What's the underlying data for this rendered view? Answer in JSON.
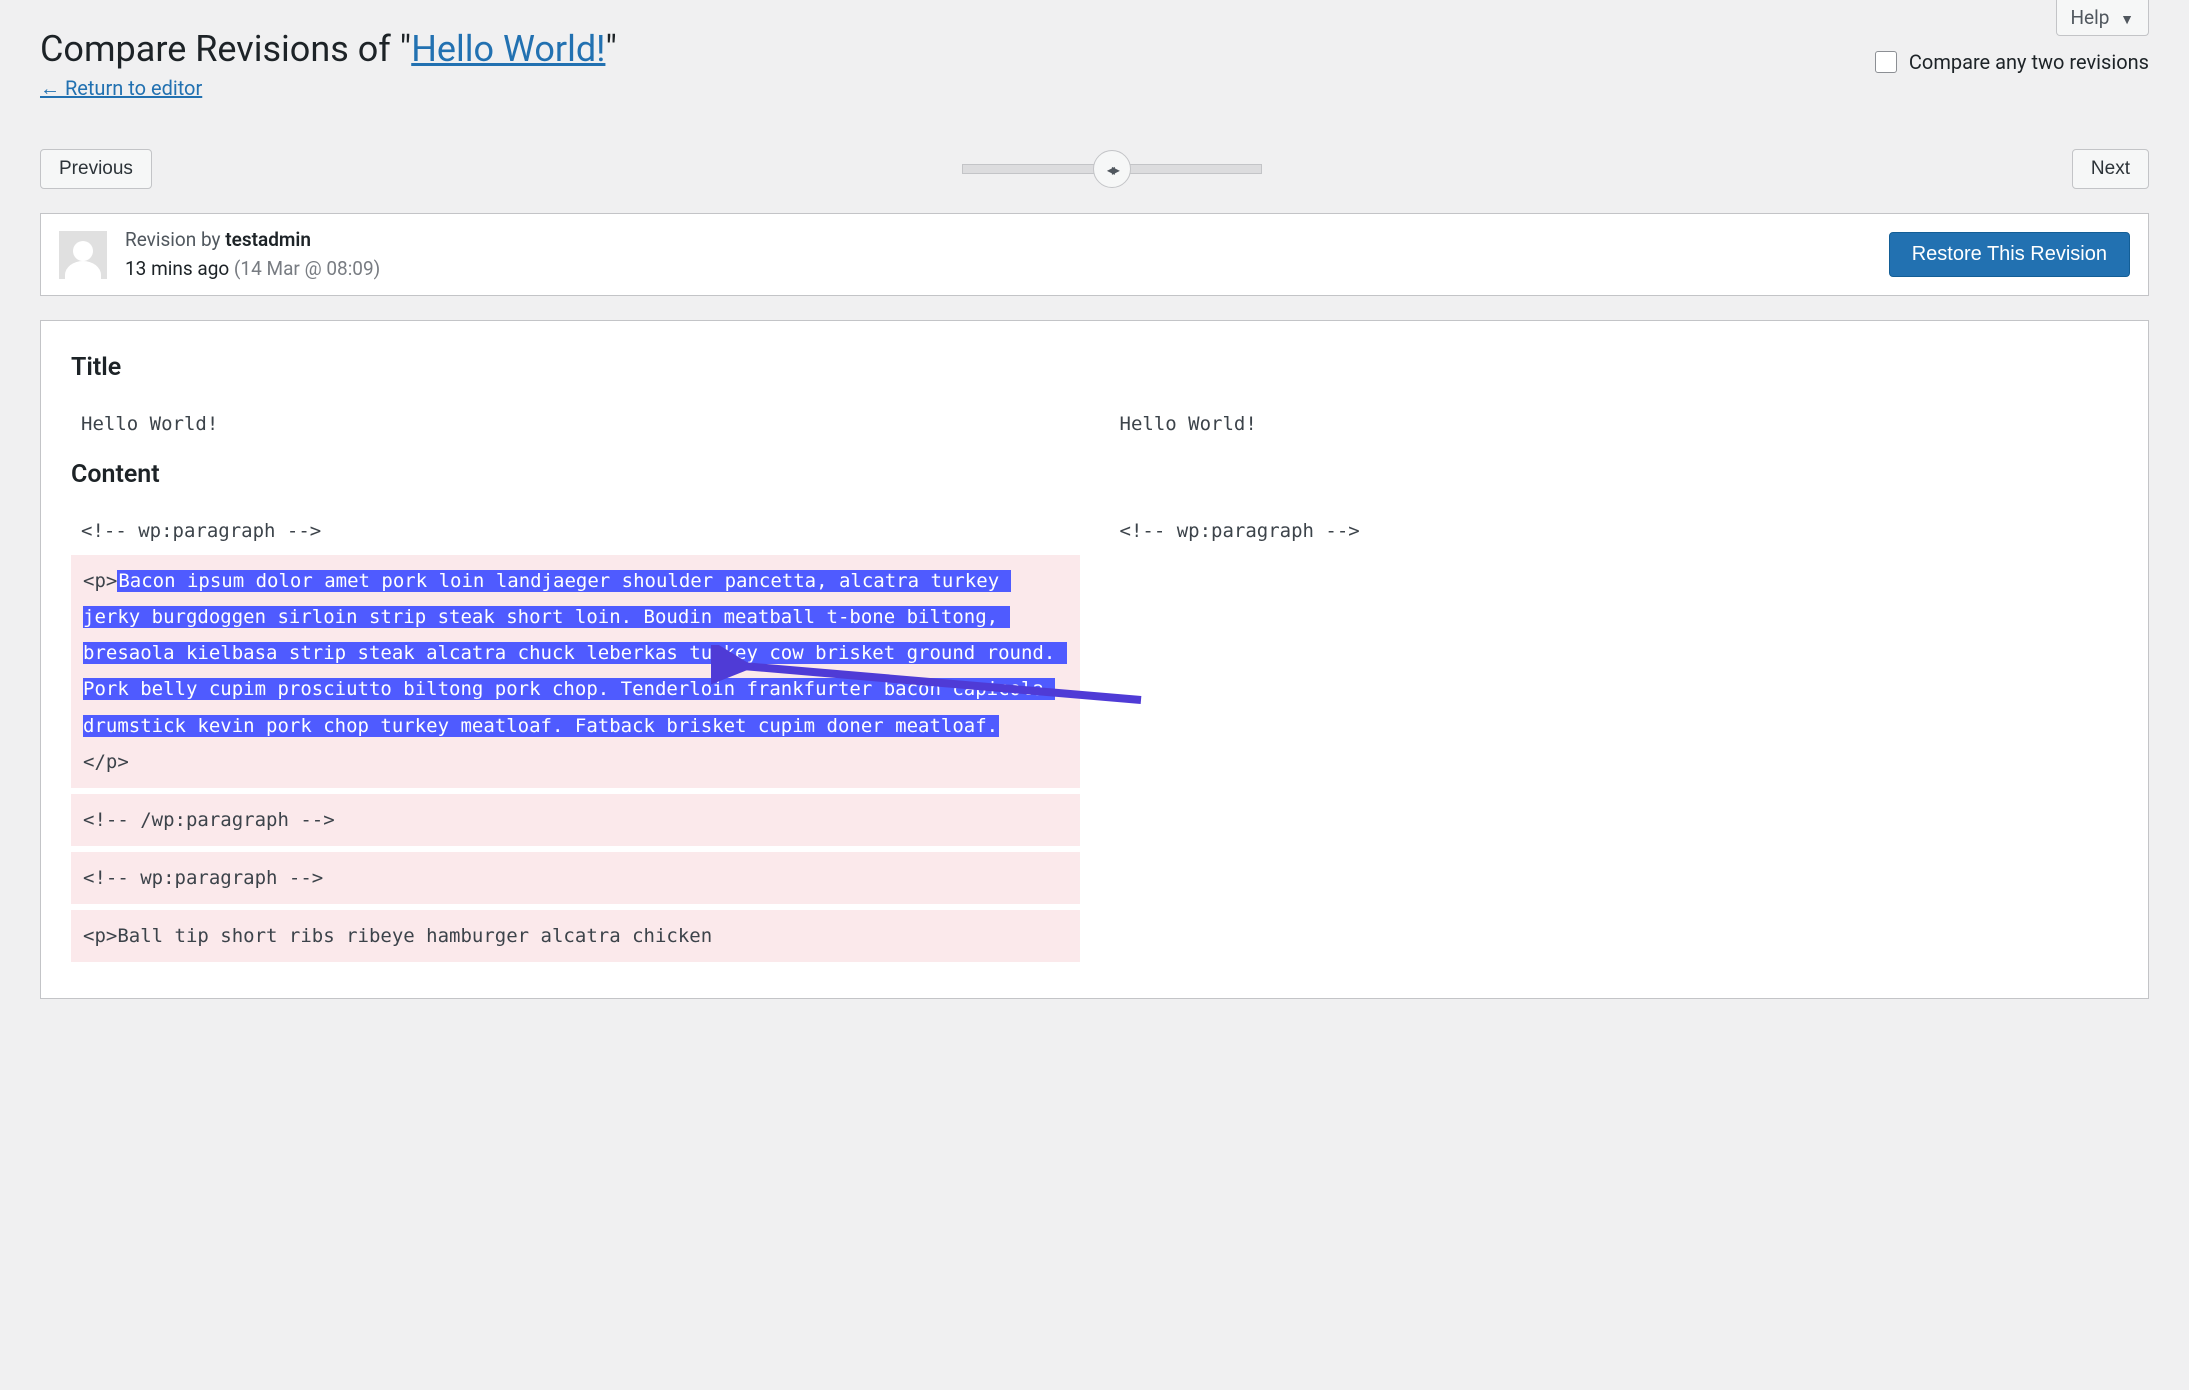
{
  "help": {
    "label": "Help"
  },
  "heading": {
    "prefix": "Compare Revisions of \"",
    "link": "Hello World!",
    "suffix": "\""
  },
  "return_link": "← Return to editor",
  "compare_checkbox_label": "Compare any two revisions",
  "nav": {
    "prev": "Previous",
    "next": "Next"
  },
  "revision_meta": {
    "by_label": "Revision by ",
    "author": "testadmin",
    "ago": "13 mins ago",
    "date": "(14 Mar @ 08:09)"
  },
  "restore_label": "Restore This Revision",
  "sections": {
    "title_heading": "Title",
    "content_heading": "Content"
  },
  "title_diff": {
    "left": "Hello World!",
    "right": "Hello World!"
  },
  "content_diff": {
    "left_line1": "<!-- wp:paragraph -->",
    "right_line1": "<!-- wp:paragraph -->",
    "left_removed_p_open": "<p>",
    "left_removed_text": "Bacon ipsum dolor amet pork loin landjaeger shoulder pancetta, alcatra turkey jerky burgdoggen sirloin strip steak short loin. Boudin meatball t-bone biltong, bresaola kielbasa strip steak alcatra chuck leberkas turkey cow brisket ground round. Pork belly cupim prosciutto biltong pork chop. Tenderloin frankfurter bacon capicola drumstick kevin pork chop turkey meatloaf. Fatback brisket cupim doner meatloaf.",
    "left_removed_p_close": "</p>",
    "left_line3": "<!-- /wp:paragraph -->",
    "left_line4": "<!-- wp:paragraph -->",
    "left_line5": "<p>Ball tip short ribs ribeye hamburger alcatra chicken"
  }
}
